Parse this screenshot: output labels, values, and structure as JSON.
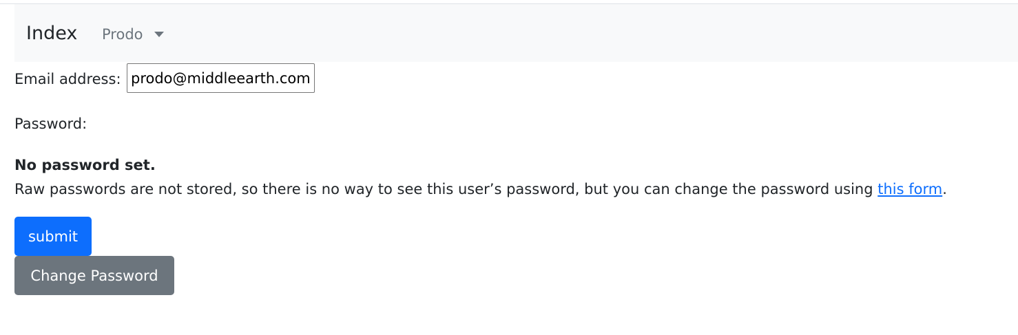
{
  "nav": {
    "brand": "Index",
    "user_menu_label": "Prodo"
  },
  "form": {
    "email_label": "Email address:",
    "email_value": "prodo@middleearth.com",
    "password_label": "Password:",
    "no_password_title": "No password set.",
    "help_text_before": "Raw passwords are not stored, so there is no way to see this user’s password, but you can change the password using ",
    "help_link_text": "this form",
    "help_text_after": "."
  },
  "buttons": {
    "submit_label": "submit",
    "change_password_label": "Change Password"
  },
  "colors": {
    "primary": "#0d6efd",
    "secondary": "#6c757d",
    "navbar_bg": "#f8f9fa"
  }
}
